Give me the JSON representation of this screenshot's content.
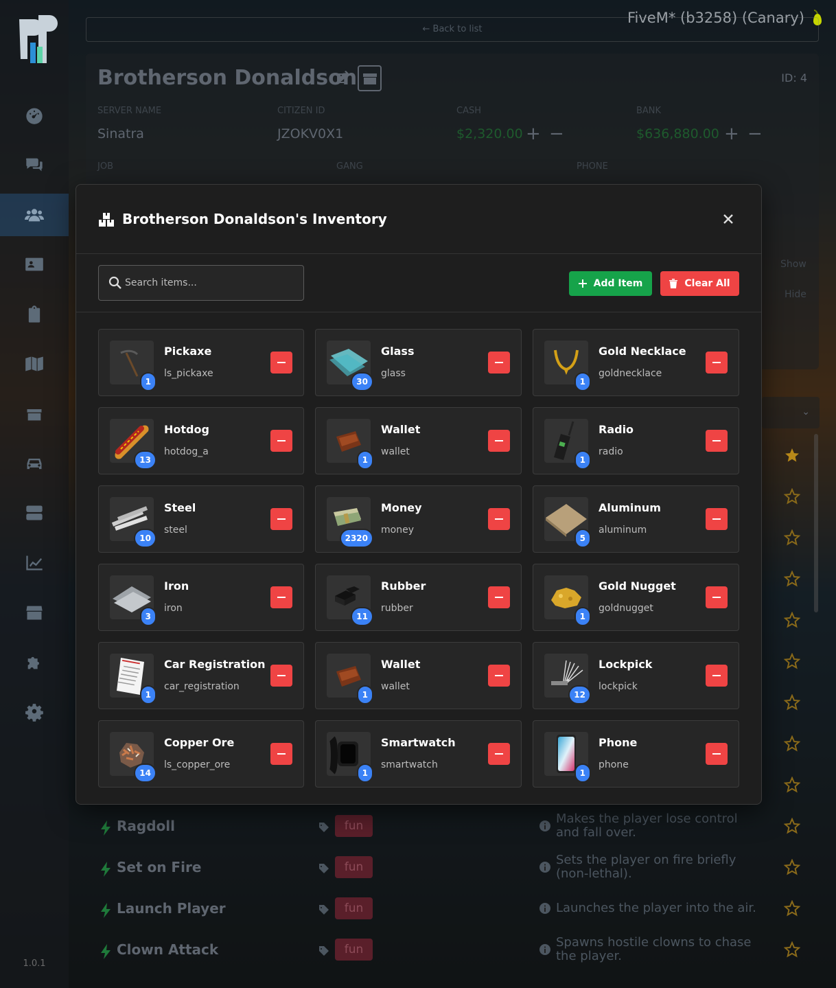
{
  "app": {
    "title": "FiveM* (b3258) (Canary)",
    "version": "1.0.1",
    "back_link": "← Back to list"
  },
  "sidebar": {
    "items": [
      {
        "icon": "dashboard-icon",
        "active": false
      },
      {
        "icon": "chat-icon",
        "active": false
      },
      {
        "icon": "players-icon",
        "active": true
      },
      {
        "icon": "id-card-icon",
        "active": false
      },
      {
        "icon": "clipboard-icon",
        "active": false
      },
      {
        "icon": "map-icon",
        "active": false
      },
      {
        "icon": "inventory-icon",
        "active": false
      },
      {
        "icon": "car-icon",
        "active": false
      },
      {
        "icon": "server-icon",
        "active": false
      },
      {
        "icon": "chart-icon",
        "active": false
      },
      {
        "icon": "store-icon",
        "active": false
      },
      {
        "icon": "puzzle-icon",
        "active": false
      },
      {
        "icon": "gear-icon",
        "active": false
      }
    ]
  },
  "player": {
    "name": "Brotherson Donaldson",
    "id_label": "ID: 4",
    "fields": {
      "server_name_label": "SERVER NAME",
      "server_name": "Sinatra",
      "citizen_id_label": "CITIZEN ID",
      "citizen_id": "JZOKV0X1",
      "cash_label": "CASH",
      "cash": "$2,320.00",
      "bank_label": "BANK",
      "bank": "$636,880.00",
      "job_label": "JOB",
      "gang_label": "GANG",
      "phone_label": "PHONE"
    },
    "show_label": "Show",
    "hide_label": "Hide"
  },
  "commands": [
    {
      "name": "Ragdoll",
      "tag": "fun",
      "desc": "Makes the player lose control and fall over."
    },
    {
      "name": "Set on Fire",
      "tag": "fun",
      "desc": "Sets the player on fire briefly (non-lethal)."
    },
    {
      "name": "Launch Player",
      "tag": "fun",
      "desc": "Launches the player into the air."
    },
    {
      "name": "Clown Attack",
      "tag": "fun",
      "desc": "Spawns hostile clowns to chase the player."
    }
  ],
  "modal": {
    "title": "Brotherson Donaldson's Inventory",
    "search_placeholder": "Search items...",
    "add_label": "Add Item",
    "clear_label": "Clear All",
    "items": [
      {
        "name": "Pickaxe",
        "code": "ls_pickaxe",
        "qty": "1",
        "icon": "pickaxe-icon"
      },
      {
        "name": "Glass",
        "code": "glass",
        "qty": "30",
        "icon": "glass-icon"
      },
      {
        "name": "Gold Necklace",
        "code": "goldnecklace",
        "qty": "1",
        "icon": "necklace-icon"
      },
      {
        "name": "Hotdog",
        "code": "hotdog_a",
        "qty": "13",
        "icon": "hotdog-icon"
      },
      {
        "name": "Wallet",
        "code": "wallet",
        "qty": "1",
        "icon": "wallet-icon"
      },
      {
        "name": "Radio",
        "code": "radio",
        "qty": "1",
        "icon": "radio-icon"
      },
      {
        "name": "Steel",
        "code": "steel",
        "qty": "10",
        "icon": "steel-icon"
      },
      {
        "name": "Money",
        "code": "money",
        "qty": "2320",
        "icon": "money-icon"
      },
      {
        "name": "Aluminum",
        "code": "aluminum",
        "qty": "5",
        "icon": "aluminum-icon"
      },
      {
        "name": "Iron",
        "code": "iron",
        "qty": "3",
        "icon": "iron-icon"
      },
      {
        "name": "Rubber",
        "code": "rubber",
        "qty": "11",
        "icon": "rubber-icon"
      },
      {
        "name": "Gold Nugget",
        "code": "goldnugget",
        "qty": "1",
        "icon": "nugget-icon"
      },
      {
        "name": "Car Registration",
        "code": "car_registration",
        "qty": "1",
        "icon": "document-icon"
      },
      {
        "name": "Wallet",
        "code": "wallet",
        "qty": "1",
        "icon": "wallet-icon"
      },
      {
        "name": "Lockpick",
        "code": "lockpick",
        "qty": "12",
        "icon": "lockpick-icon"
      },
      {
        "name": "Copper Ore",
        "code": "ls_copper_ore",
        "qty": "14",
        "icon": "ore-icon"
      },
      {
        "name": "Smartwatch",
        "code": "smartwatch",
        "qty": "1",
        "icon": "smartwatch-icon"
      },
      {
        "name": "Phone",
        "code": "phone",
        "qty": "1",
        "icon": "phone-icon"
      }
    ]
  },
  "colors": {
    "accent_blue": "#3b82f6",
    "add_green": "#16a34a",
    "danger_red": "#ef4444",
    "modal_bg": "#1e1e1e",
    "card_bg": "#262626"
  }
}
